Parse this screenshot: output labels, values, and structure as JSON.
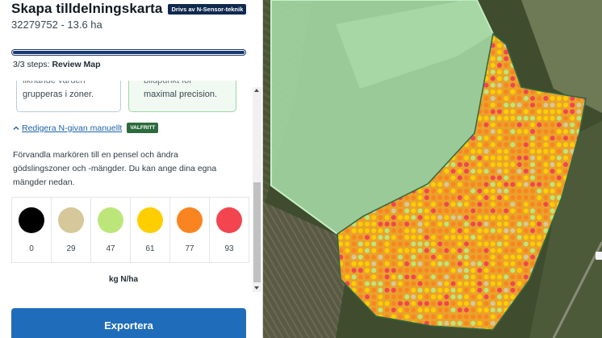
{
  "header": {
    "title": "Skapa tilldelningskarta",
    "badge": "Drivs av N-Sensor-teknik",
    "subtitle": "32279752 - 13.6 ha"
  },
  "progress": {
    "fraction": 1.0,
    "steps_prefix": "3/3 steps:",
    "steps_label": "Review Map"
  },
  "cards": {
    "left": {
      "line1": "liknande värden",
      "line2": "grupperas i zoner."
    },
    "right": {
      "line1": "bildpunkt för",
      "line2": "maximal precision."
    }
  },
  "edit": {
    "link_label": "Redigera N-givan manuellt",
    "optional_badge": "VALFRITT"
  },
  "description": "Förvandla markören till en pensel och ändra gödslingszoner och -mängder. Du kan ange dina egna mängder nedan.",
  "legend": {
    "items": [
      {
        "value": "0",
        "color": "#000000"
      },
      {
        "value": "29",
        "color": "#d6c89a"
      },
      {
        "value": "47",
        "color": "#bde67a"
      },
      {
        "value": "61",
        "color": "#fece00"
      },
      {
        "value": "77",
        "color": "#fa8520"
      },
      {
        "value": "93",
        "color": "#f2454f"
      }
    ],
    "unit": "kg N/ha"
  },
  "actions": {
    "export_label": "Exportera"
  },
  "colors": {
    "accent": "#1f6dba",
    "badge_navy": "#10294f",
    "optional_green": "#2d6b3e",
    "field_overlay": "#a6dca6"
  },
  "icons": {
    "edit_link": "chevron-up-icon",
    "scroll_up": "arrow-up-icon",
    "scroll_down": "arrow-down-icon"
  }
}
